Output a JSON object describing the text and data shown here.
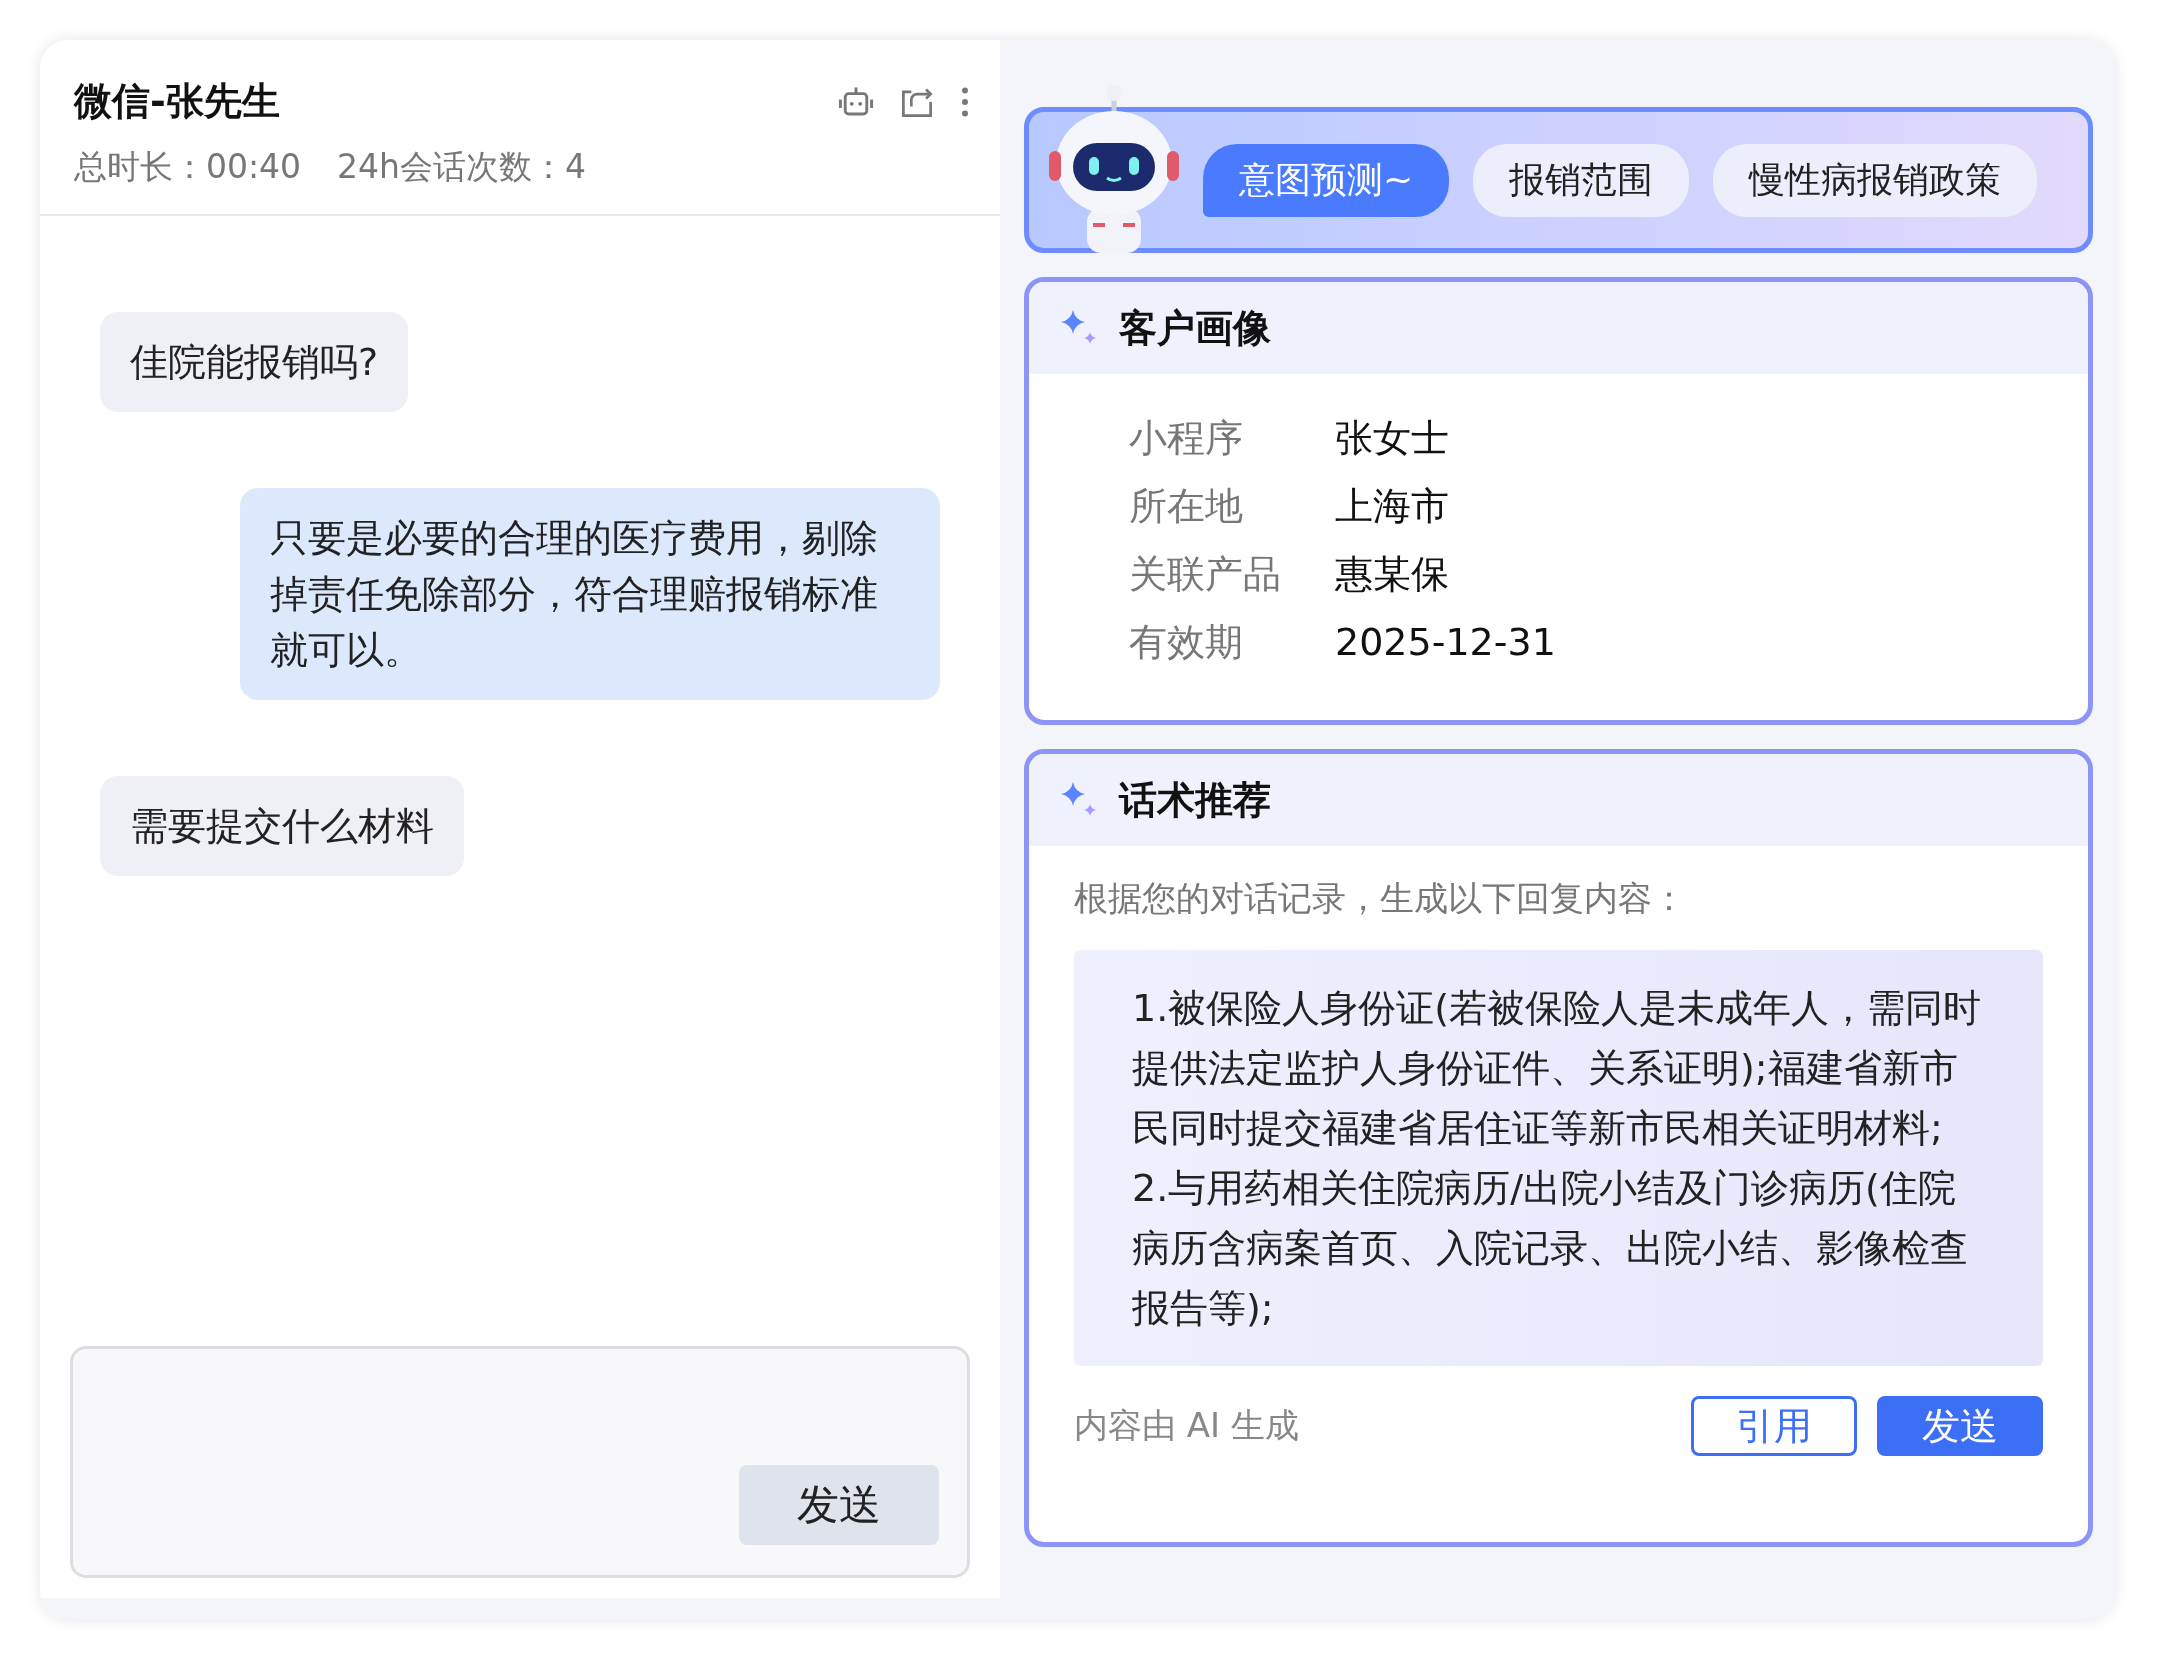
{
  "chat": {
    "title": "微信-张先生",
    "duration": "总时长：00:40",
    "session_count": "24h会话次数：4",
    "messages": [
      {
        "kind": "incoming",
        "text": "佳院能报销吗?"
      },
      {
        "kind": "outgoing",
        "text": "只要是必要的合理的医疗费用，剔除掉责任免除部分，符合理赔报销标准就可以。"
      },
      {
        "kind": "incoming",
        "text": "需要提交什么材料"
      }
    ],
    "send_button": "发送"
  },
  "intent": {
    "label": "意图预测~",
    "tags": [
      "报销范围",
      "慢性病报销政策"
    ]
  },
  "profile": {
    "title": "客户画像",
    "fields": [
      {
        "label": "小程序",
        "value": "张女士"
      },
      {
        "label": "所在地",
        "value": "上海市"
      },
      {
        "label": "关联产品",
        "value": "惠某保"
      },
      {
        "label": "有效期",
        "value": "2025-12-31"
      }
    ]
  },
  "script": {
    "title": "话术推荐",
    "intro": "根据您的对话记录，生成以下回复内容：",
    "lines": [
      "1.被保险人身份证(若被保险人是未成年人，需同时提供法定监护人身份证件、关系证明);福建省新市民同时提交福建省居住证等新市民相关证明材料;",
      "2.与用药相关住院病历/出院小结及门诊病历(住院病历含病案首页、入院记录、出院小结、影像检查报告等);"
    ],
    "note": "内容由 AI 生成",
    "quote_button": "引用",
    "send_button": "发送"
  }
}
